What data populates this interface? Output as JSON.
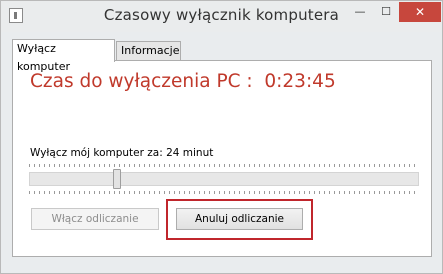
{
  "window": {
    "title": "Czasowy wyłącznik  komputera",
    "minimize_glyph": "—",
    "maximize_glyph": "☐",
    "close_glyph": "✕"
  },
  "tabs": [
    {
      "label": "Wyłącz komputer",
      "active": true
    },
    {
      "label": "Informacje",
      "active": false
    }
  ],
  "countdown": {
    "label": "Czas do wyłączenia PC :",
    "time": "0:23:45"
  },
  "shutdown_info": "Wyłącz mój komputer za: 24 minut",
  "slider": {
    "value_fraction": 0.22
  },
  "buttons": {
    "start_label": "Włącz odliczanie",
    "cancel_label": "Anuluj odliczanie"
  },
  "colors": {
    "countdown_text": "#c0392b",
    "highlight_border": "#c0262c",
    "close_button": "#c7473d"
  },
  "icons": {
    "app": "app-window-icon",
    "minimize": "minimize-icon",
    "maximize": "maximize-icon",
    "close": "close-icon"
  }
}
